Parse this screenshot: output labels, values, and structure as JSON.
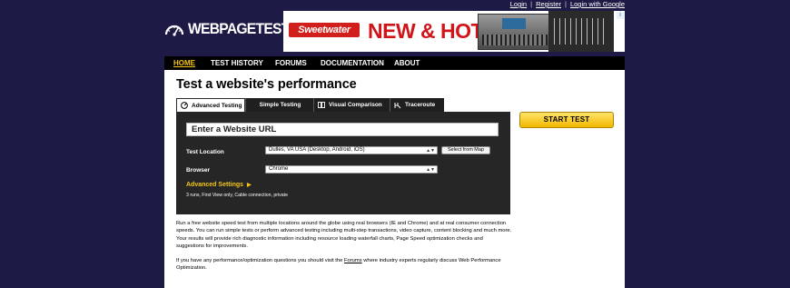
{
  "top_links": {
    "login": "Login",
    "sep1": "|",
    "register": "Register",
    "sep2": "|",
    "login_google": "Login with Google"
  },
  "logo": {
    "text_bold": "WEB",
    "text_light": "PAGETEST"
  },
  "ad": {
    "brand": "Sweetwater",
    "headline": "NEW & HOT",
    "info_icon": "ad-info-icon"
  },
  "nav": {
    "items": [
      {
        "label": "HOME",
        "active": true
      },
      {
        "label": "TEST HISTORY"
      },
      {
        "label": "FORUMS"
      },
      {
        "label": "DOCUMENTATION"
      },
      {
        "label": "ABOUT"
      }
    ]
  },
  "page": {
    "title": "Test a website's performance"
  },
  "tabs": [
    {
      "label": "Advanced Testing",
      "icon": "gauge-icon",
      "active": true
    },
    {
      "label": "Simple Testing"
    },
    {
      "label": "Visual Comparison",
      "icon": "compare-icon"
    },
    {
      "label": "Traceroute",
      "icon": "traceroute-icon"
    }
  ],
  "form": {
    "url_placeholder": "Enter a Website URL",
    "test_location_label": "Test Location",
    "test_location_value": "Dulles, VA USA (Desktop, Android, iOS)",
    "select_map_button": "Select from Map",
    "browser_label": "Browser",
    "browser_value": "Chrome",
    "advanced_settings": "Advanced Settings",
    "advanced_arrow": "▶",
    "advanced_summary": "3 runs, First View only, Cable connection, private"
  },
  "start_button": "START TEST",
  "description": {
    "paragraph1": "Run a free website speed test from multiple locations around the globe using real browsers (IE and Chrome) and at real consumer connection speeds. You can run simple tests or perform advanced testing including multi-step transactions, video capture, content blocking and much more. Your results will provide rich diagnostic information including resource loading waterfall charts, Page Speed optimization checks and suggestions for improvements.",
    "paragraph2_before": "If you have any performance/optimization questions you should visit the ",
    "paragraph2_link": "Forums",
    "paragraph2_after": " where industry experts regularly discuss Web Performance Optimization."
  },
  "colors": {
    "background": "#1d1b45",
    "accent_yellow": "#f5c518",
    "panel": "#262626",
    "nav": "#000000",
    "ad_red": "#d0141a"
  }
}
